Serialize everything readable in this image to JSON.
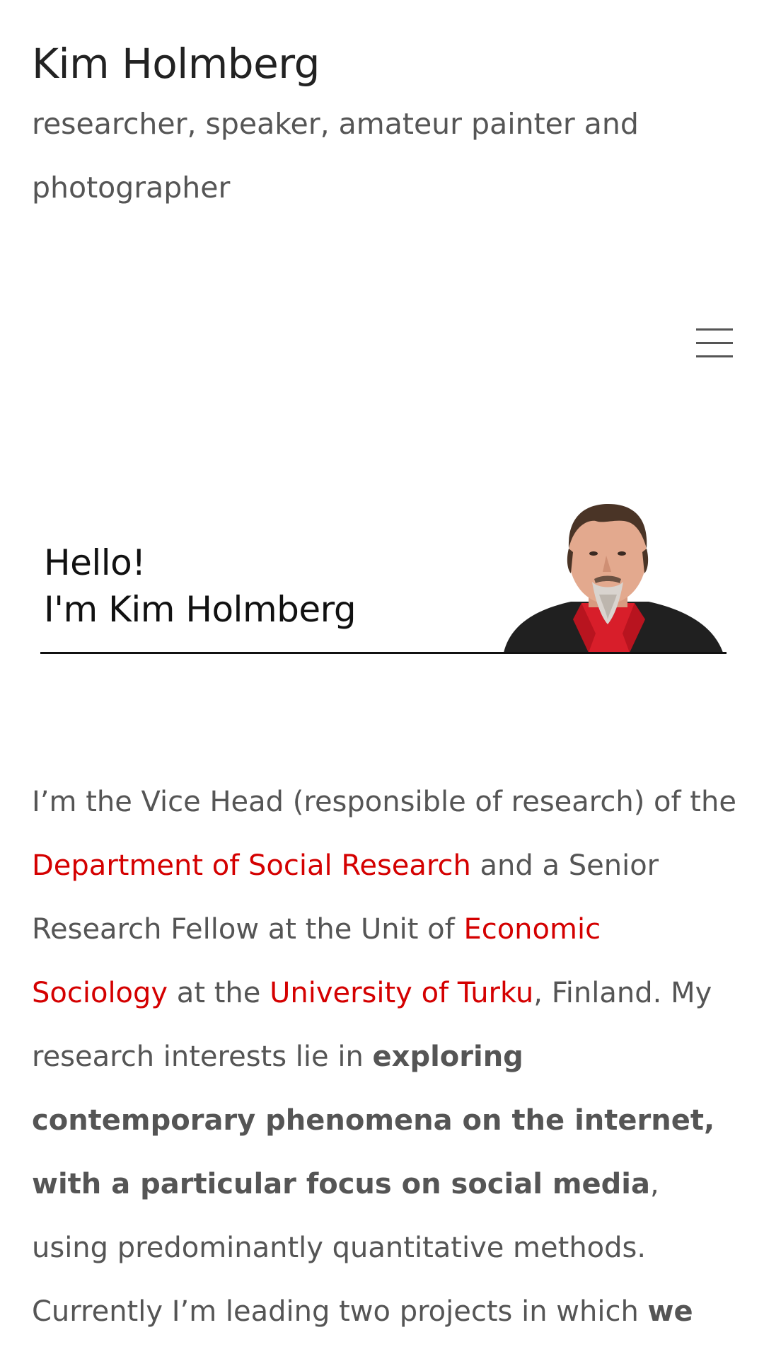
{
  "site": {
    "title": "Kim Holmberg",
    "tagline": "researcher, speaker, amateur painter and photographer"
  },
  "header": {
    "menu_icon": "hamburger-menu-icon"
  },
  "hero": {
    "line1": "Hello!",
    "line2": "I'm Kim Holmberg",
    "portrait_icon": "portrait-photo"
  },
  "intro": {
    "t1": "I’m the Vice Head (responsible of research) of the ",
    "link1": "Department of Social Research",
    "t2": " and a Senior Research Fellow at the Unit of ",
    "link2": "Economic Sociology",
    "t3": " at the ",
    "link3": "University of Turku",
    "t4": ", Finland. My research interests lie in ",
    "b1": "exploring contemporary phenomena on the internet, with a particular focus on social media",
    "t5": ", using predominantly quantitative methods. Currently I’m leading two projects in which ",
    "b2": "we are"
  },
  "colors": {
    "link": "#d40000",
    "text": "#555555",
    "title": "#222222"
  }
}
